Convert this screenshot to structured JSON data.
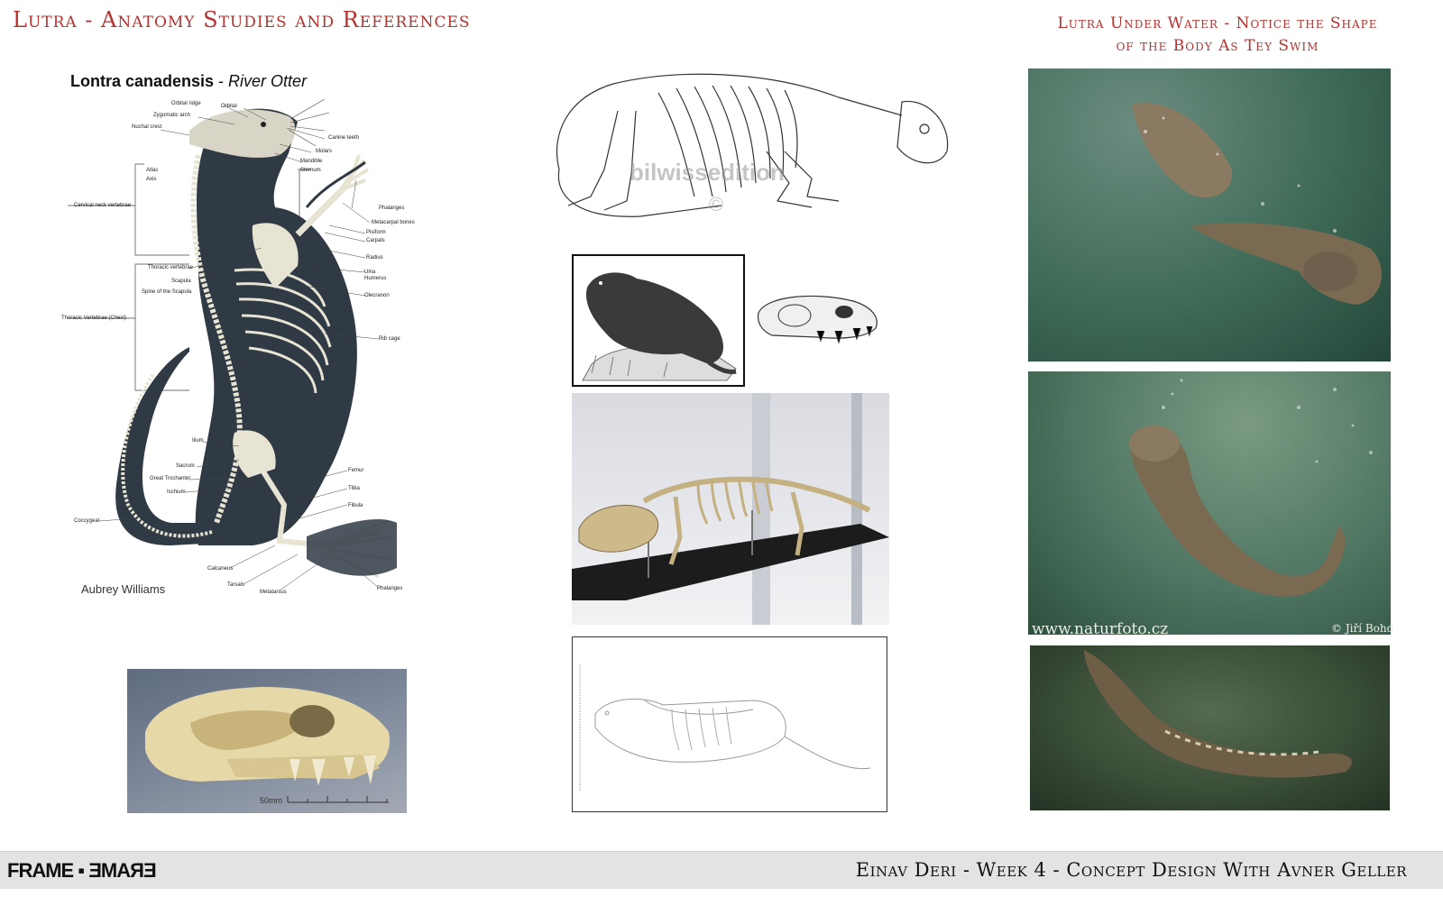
{
  "header": {
    "title": "Lutra - Anatomy Studies and References",
    "subtitle_line1": "Lutra Under Water - Notice the Shape",
    "subtitle_line2": "of the Body As Tey Swim"
  },
  "anatomy_chart": {
    "title_bold": "Lontra canadensis",
    "title_sep": " - ",
    "title_italic": "River Otter",
    "credit": "Aubrey Williams",
    "labels": {
      "orbital_ridge": "Orbital ridge",
      "orbital": "Orbital",
      "zygomatic_arch": "Zygomatic arch",
      "nuchal_crest": "Nuchal crest",
      "canine_teeth": "Canine teeth",
      "molars": "Molars",
      "mandible": "Mandible",
      "sternum": "Sternum",
      "atlas": "Atlas",
      "axis": "Axis",
      "cervical": "Cervical neck vertebrae",
      "phalanges_top": "Phalanges",
      "metacarpal": "Metacarpal bones",
      "pisiform": "Pisiform",
      "carpals": "Carpals",
      "radius": "Radius",
      "ulna": "Ulna",
      "humerus": "Humerus",
      "olecranon": "Olecranon",
      "thoracic_vertebrae": "Thoracic vertebrae",
      "scapula": "Scapula",
      "spine_scapula": "Spine of the Scapula",
      "thoracic_chest": "Thoracic Vertebrae (Chest)",
      "rib_cage": "Rib cage",
      "ilium": "Ilium",
      "sacrum": "Sacrum",
      "great_trochanter": "Great Trochanter",
      "ischium": "Ischium",
      "coccygeal": "Coccygeal",
      "femur": "Femur",
      "tibia": "Tibia",
      "fibula": "Fibula",
      "calcaneus": "Calcaneus",
      "tarsals": "Tarsals",
      "metatarsus": "Metatarsus",
      "phalanges_bottom": "Phalanges"
    }
  },
  "skeleton_sketch": {
    "watermark": "bilwissedition",
    "watermark_symbol": "©"
  },
  "skull_photo": {
    "scale_label": "50mm"
  },
  "underwater_photo": {
    "url": "www.naturfoto.cz",
    "copyright": "© Jiří Bohd"
  },
  "footer": {
    "logo": "FRAME ▪ ƎMAЯƎ",
    "text": "Einav Deri - Week 4 - Concept Design With Avner Geller"
  },
  "colors": {
    "accent_red": "#b5322f",
    "underwater_green": "#3f6a57",
    "otter_body": "#2f3a44",
    "bone": "#e8e4d4"
  }
}
